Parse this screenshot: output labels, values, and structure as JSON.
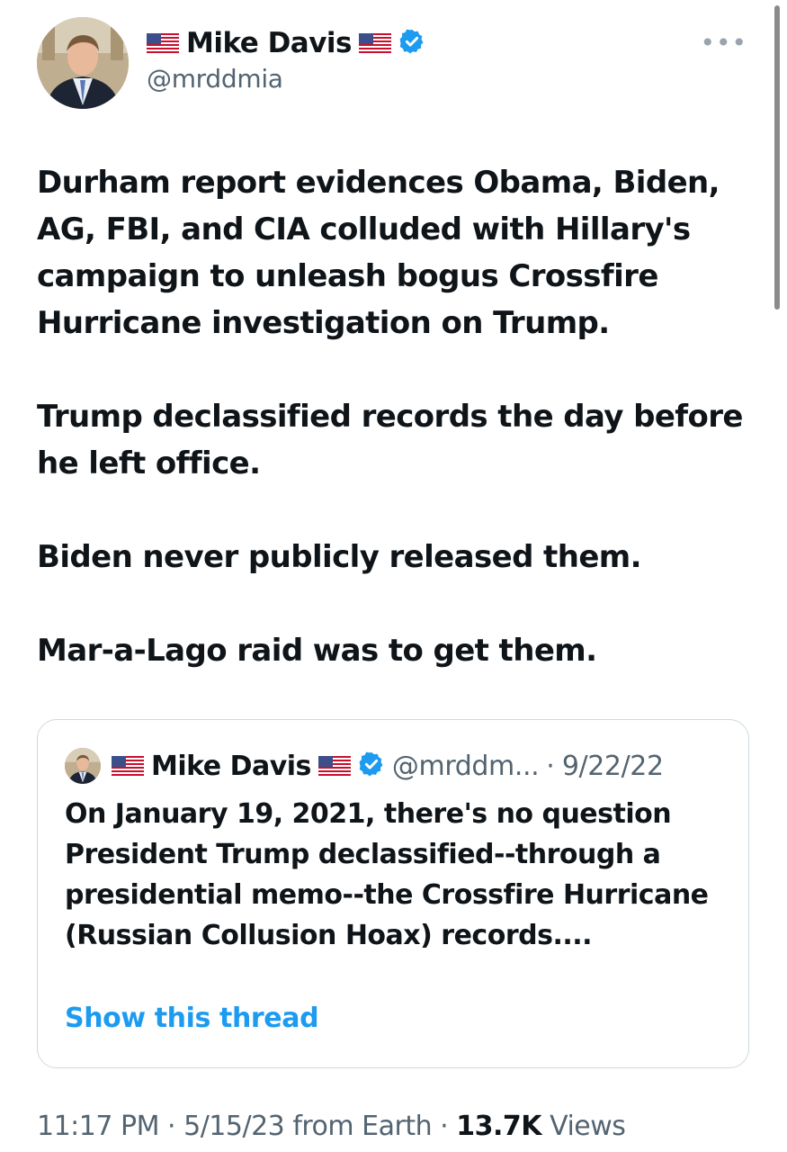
{
  "author": {
    "name": "Mike Davis",
    "handle": "@mrddmia"
  },
  "icons": {
    "flag": "us-flag-icon",
    "verified": "verified-badge-icon",
    "more": "more-options-icon"
  },
  "colors": {
    "verified": "#1d9bf0",
    "link": "#1d9bf0",
    "secondary_text": "#536471",
    "text": "#0f1419"
  },
  "tweet": {
    "paragraphs": [
      "Durham report evidences Obama, Biden, AG, FBI, and CIA colluded with Hillary's campaign to unleash bogus Crossfire Hurricane investigation on Trump.",
      "Trump declassified records the day before he left office.",
      "Biden never publicly released them.",
      "Mar-a-Lago raid was to get them."
    ]
  },
  "quoted_tweet": {
    "name": "Mike Davis",
    "handle": "@mrddm...",
    "separator": "·",
    "date": "9/22/22",
    "text": "On January 19, 2021, there's no question President Trump declassified--through a presidential memo--the Crossfire Hurricane (Russian Collusion Hoax) records....",
    "show_thread_label": "Show this thread"
  },
  "meta": {
    "time": "11:17 PM",
    "separator": "·",
    "date": "5/15/23",
    "source": "from Earth",
    "views_count": "13.7K",
    "views_label": "Views"
  }
}
